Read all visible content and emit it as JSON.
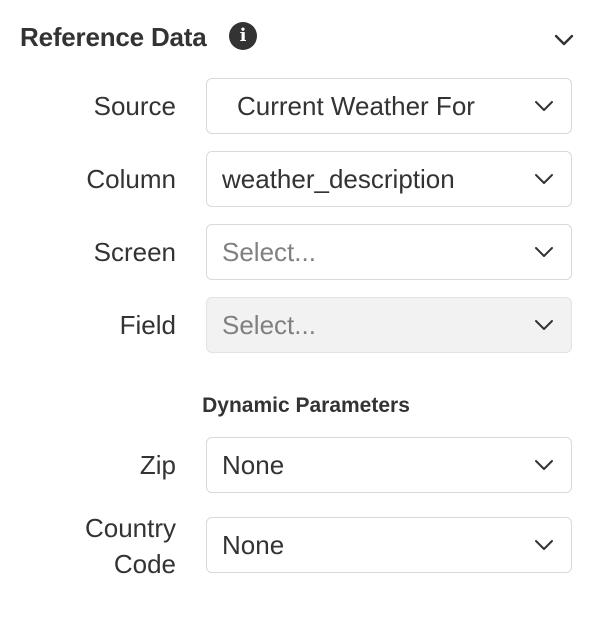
{
  "panel": {
    "title": "Reference Data",
    "info_icon": "info-icon",
    "collapse_icon": "chevron-down-icon"
  },
  "fields": {
    "source": {
      "label": "Source",
      "value": "Current Weather For"
    },
    "column": {
      "label": "Column",
      "value": "weather_description"
    },
    "screen": {
      "label": "Screen",
      "value": "Select..."
    },
    "field": {
      "label": "Field",
      "value": "Select..."
    }
  },
  "dynamic_parameters": {
    "heading": "Dynamic Parameters",
    "zip": {
      "label": "Zip",
      "value": "None"
    },
    "country_code": {
      "label_line1": "Country",
      "label_line2": "Code",
      "value": "None"
    }
  },
  "colors": {
    "text": "#333333",
    "placeholder": "#808080",
    "border": "#d9d9d9",
    "disabled_bg": "#f2f2f2"
  }
}
